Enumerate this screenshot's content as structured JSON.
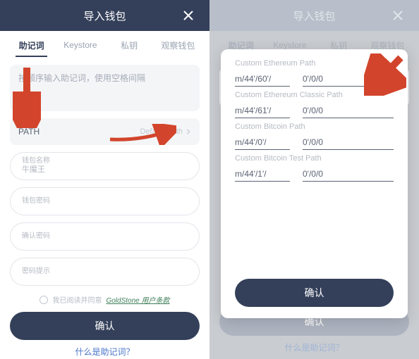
{
  "header": {
    "title": "导入钱包"
  },
  "tabs": [
    {
      "label": "助记词",
      "active": true
    },
    {
      "label": "Keystore",
      "active": false
    },
    {
      "label": "私钥",
      "active": false
    },
    {
      "label": "观察钱包",
      "active": false
    }
  ],
  "left": {
    "mnemonic_placeholder": "按顺序输入助记词，使用空格间隔",
    "path_label": "PATH",
    "path_value": "Default Path",
    "fields": {
      "name_label": "钱包名称",
      "name_value": "牛魔王",
      "password_label": "钱包密码",
      "confirm_label": "确认密码",
      "hint_label": "密码提示"
    },
    "terms_prefix": "我已阅读并同意",
    "terms_link": "GoldStone 用户条款",
    "confirm": "确认",
    "footer": "什么是助记词？"
  },
  "right": {
    "confirm": "确认",
    "footer": "什么是助记词？",
    "modal_confirm": "确认",
    "paths": [
      {
        "title": "Custom Ethereum Path",
        "seg1": "m/44'/60'/",
        "seg2": "0'/0/0"
      },
      {
        "title": "Custom Ethereum Classic Path",
        "seg1": "m/44'/61'/",
        "seg2": "0'/0/0"
      },
      {
        "title": "Custom Bitcoin Path",
        "seg1": "m/44'/0'/",
        "seg2": "0'/0/0"
      },
      {
        "title": "Custom Bitcoin Test Path",
        "seg1": "m/44'/1'/",
        "seg2": "0'/0/0"
      }
    ]
  },
  "colors": {
    "accent": "#34405a"
  }
}
